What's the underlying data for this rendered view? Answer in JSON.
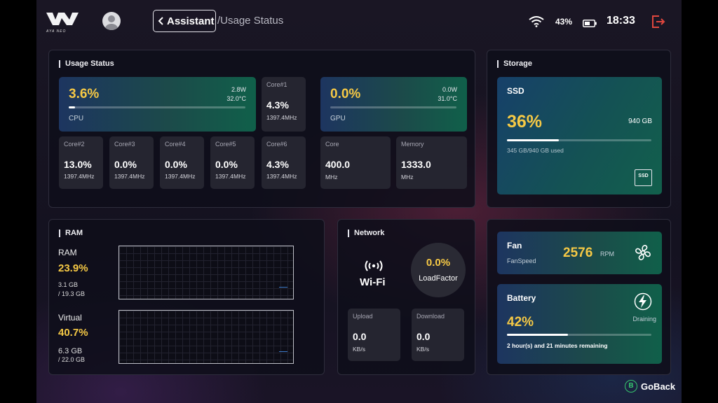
{
  "header": {
    "logo_text": "AYA NEO",
    "back_label": "Assistant",
    "breadcrumb": "/Usage Status",
    "battery_pct": "43%",
    "time": "18:33"
  },
  "usage": {
    "title": "Usage Status",
    "cpu": {
      "value": "3.6%",
      "label": "CPU",
      "power": "2.8W",
      "temp": "32.0°C",
      "level": 0.036
    },
    "gpu": {
      "value": "0.0%",
      "label": "GPU",
      "power": "0.0W",
      "temp": "31.0°C",
      "level": 0.0
    },
    "cores": [
      {
        "name": "Core#1",
        "value": "4.3%",
        "freq": "1397.4MHz"
      },
      {
        "name": "Core#2",
        "value": "13.0%",
        "freq": "1397.4MHz"
      },
      {
        "name": "Core#3",
        "value": "0.0%",
        "freq": "1397.4MHz"
      },
      {
        "name": "Core#4",
        "value": "0.0%",
        "freq": "1397.4MHz"
      },
      {
        "name": "Core#5",
        "value": "0.0%",
        "freq": "1397.4MHz"
      },
      {
        "name": "Core#6",
        "value": "4.3%",
        "freq": "1397.4MHz"
      }
    ],
    "gpu_core": {
      "name": "Core",
      "value": "400.0",
      "unit": "MHz"
    },
    "gpu_memory": {
      "name": "Memory",
      "value": "1333.0",
      "unit": "MHz"
    }
  },
  "storage": {
    "title": "Storage",
    "type": "SSD",
    "percent": "36%",
    "level": 0.36,
    "total": "940 GB",
    "used": "345 GB/940 GB used",
    "icon_text": "SSD"
  },
  "ram": {
    "title": "RAM",
    "ram_label": "RAM",
    "ram_percent": "23.9%",
    "ram_used": "3.1 GB",
    "ram_total": "/ 19.3 GB",
    "virtual_label": "Virtual",
    "virtual_percent": "40.7%",
    "virtual_used": "6.3 GB",
    "virtual_total": "/ 22.0 GB"
  },
  "network": {
    "title": "Network",
    "type": "Wi-Fi",
    "load_value": "0.0%",
    "load_label": "LoadFactor",
    "upload_label": "Upload",
    "upload_value": "0.0",
    "upload_unit": "KB/s",
    "download_label": "Download",
    "download_value": "0.0",
    "download_unit": "KB/s"
  },
  "fan": {
    "title": "Fan",
    "subtitle": "FanSpeed",
    "value": "2576",
    "unit": "RPM"
  },
  "battery": {
    "title": "Battery",
    "state": "Draining",
    "percent": "42%",
    "level": 0.42,
    "remaining": "2 hour(s) and 21 minutes remaining"
  },
  "footer": {
    "button_glyph": "B",
    "goback_label": "GoBack"
  },
  "colors": {
    "accent_yellow": "#f6c945",
    "logout_red": "#e0473e",
    "goback_green": "#36c66e"
  }
}
